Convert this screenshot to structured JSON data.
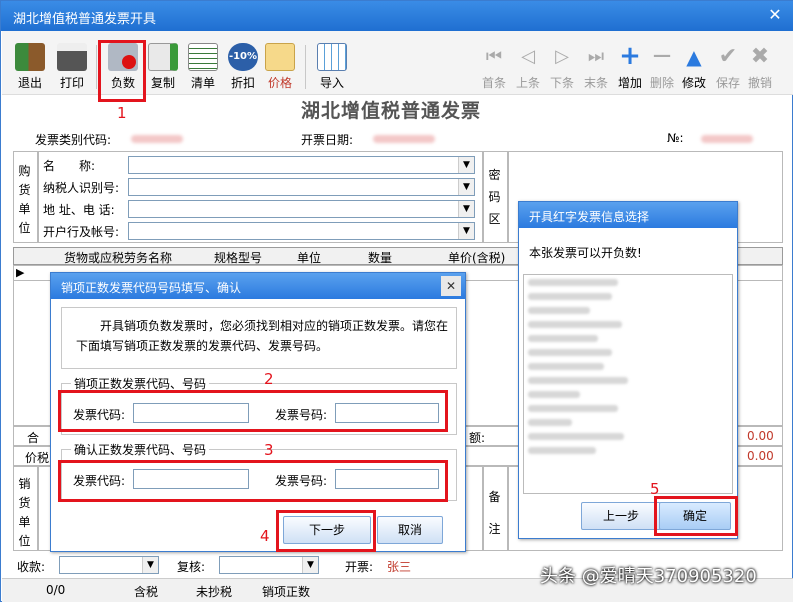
{
  "window": {
    "title": "湖北增值税普通发票开具",
    "close": "✕"
  },
  "toolbar": {
    "exit": "退出",
    "print": "打印",
    "negative": "负数",
    "copy": "复制",
    "list": "清单",
    "discount": "折扣",
    "price": "价格",
    "import": "导入",
    "first": "首条",
    "prev": "上条",
    "next": "下条",
    "last": "末条",
    "add": "增加",
    "delete": "删除",
    "modify": "修改",
    "save": "保存",
    "revoke": "撤销",
    "discount_badge": "-10%"
  },
  "annotations": {
    "n1": "1",
    "n2": "2",
    "n3": "3",
    "n4": "4",
    "n5": "5"
  },
  "invoice": {
    "heading": "湖北增值税普通发票",
    "code_label": "发票类别代码:",
    "date_label": "开票日期:",
    "no_label": "№:",
    "buyer_group": "购货单位",
    "name_label": "名　　称:",
    "taxid_label": "纳税人识别号:",
    "address_label": "地 址、电 话:",
    "bank_label": "开户行及帐号:",
    "cipher": "密码区",
    "columns": [
      "货物或应税劳务名称",
      "规格型号",
      "单位",
      "数量",
      "单价(含税)"
    ],
    "total_label": "合",
    "price_tax_label": "价税",
    "amount_label": "额:",
    "total_value": "0.00",
    "price_tax_value": "0.00",
    "seller_group": "销货单位",
    "remark": "备注",
    "receipt_label": "收款:",
    "review_label": "复核:",
    "drawer_label": "开票:",
    "drawer_value": "张三"
  },
  "dialog_left": {
    "title": "销项正数发票代码号码填写、确认",
    "message": "开具销项负数发票时，您必须找到相对应的销项正数发票。请您在下面填写销项正数发票的发票代码、发票号码。",
    "group1": "销项正数发票代码、号码",
    "group2": "确认正数发票代码、号码",
    "code_label": "发票代码:",
    "number_label": "发票号码:",
    "next_button": "下一步",
    "cancel_button": "取消"
  },
  "dialog_right": {
    "title": "开具红字发票信息选择",
    "message": "本张发票可以开负数!",
    "prev_button": "上一步",
    "ok_button": "确定"
  },
  "statusbar": {
    "count": "0/0",
    "tax_incl": "含税",
    "not_copied": "未抄税",
    "positive": "销项正数"
  },
  "watermark": "头条 @爱晴天370905320",
  "colors": {
    "accent": "#2b7adf",
    "annotation_red": "#e3141d"
  }
}
